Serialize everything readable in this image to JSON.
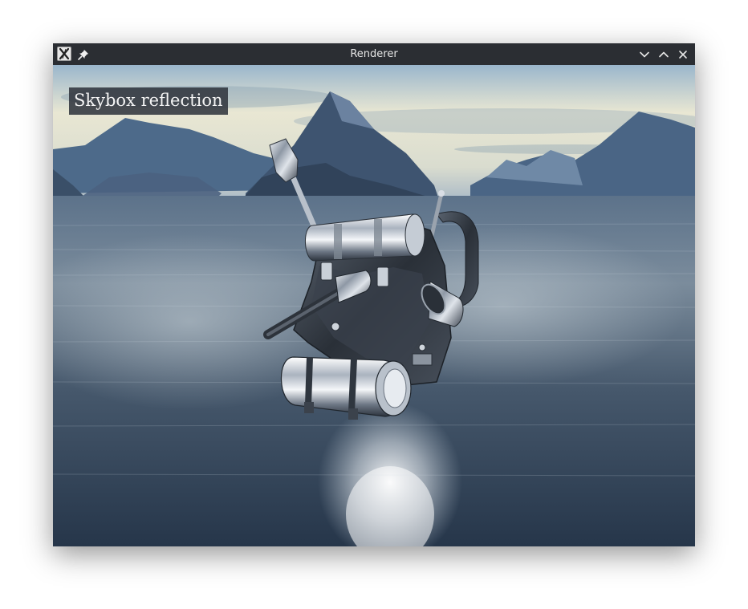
{
  "window": {
    "title": "Renderer",
    "app_icon": "x-window-icon",
    "pin_icon": "pin-icon",
    "controls": [
      {
        "name": "minimize-button",
        "icon": "chevron-down-icon"
      },
      {
        "name": "maximize-button",
        "icon": "chevron-up-icon"
      },
      {
        "name": "close-button",
        "icon": "close-icon"
      }
    ]
  },
  "scene": {
    "label": "Skybox reflection",
    "colors": {
      "sky_top": "#8fb0c9",
      "sky_horizon": "#ecead8",
      "mountains": "#3f5878",
      "water_near": "#2a3a4d",
      "water_far": "#6f8397",
      "chrome": "#b9c1cb"
    }
  }
}
